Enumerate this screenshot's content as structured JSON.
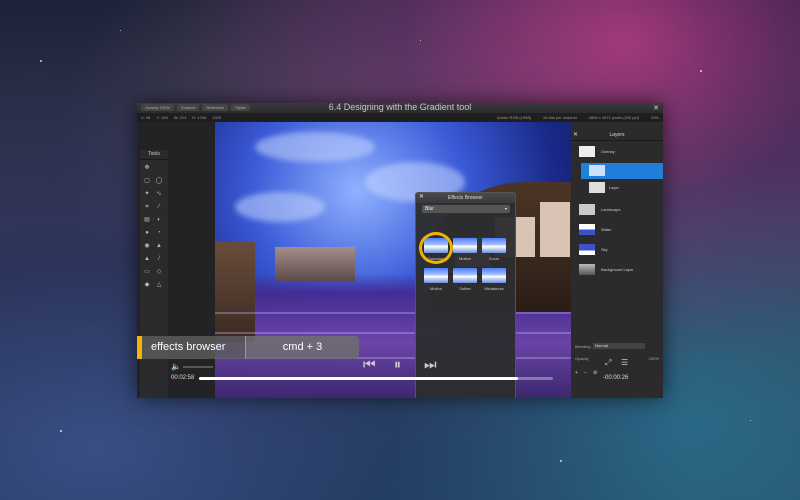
{
  "window": {
    "title": "6.4 Designing with the Gradient tool",
    "tabs": [
      "Opacity 100%",
      "Shadow",
      "Reflection",
      "Styles"
    ],
    "info_left": [
      "X: 98",
      "Y: 158",
      "W: 214",
      "H: 1246",
      "1325"
    ],
    "info_right": [
      "Adobe RGB (1998)",
      "16 bits per channel",
      "4896 x 3472 pixels (300 ppi)",
      "29%"
    ]
  },
  "tools": {
    "title": "Tools"
  },
  "effects_browser": {
    "title": "Effects Browser",
    "category": "Blur",
    "items": [
      {
        "label": "Gaussian"
      },
      {
        "label": "Motion"
      },
      {
        "label": "Zoom"
      },
      {
        "label": "Motion"
      },
      {
        "label": "Soften"
      },
      {
        "label": "Miniaturize"
      }
    ]
  },
  "layers": {
    "title": "Layers",
    "items": [
      {
        "name": "Overlay"
      },
      {
        "name": ""
      },
      {
        "name": "Layer"
      },
      {
        "name": "Landscape"
      },
      {
        "name": "Water"
      },
      {
        "name": "Sky"
      },
      {
        "name": "Background Layer"
      }
    ],
    "blending_label": "Blending",
    "blending_value": "Normal",
    "opacity_label": "Opacity",
    "opacity_value": "100%"
  },
  "player": {
    "time_current": "00:02:58",
    "time_remaining": "-00:00:26",
    "progress": 0.9
  },
  "shortcut": {
    "name": "effects browser",
    "keys": "cmd + 3"
  },
  "colors": {
    "accent": "#f4b400",
    "selection": "#1f7fd9"
  }
}
